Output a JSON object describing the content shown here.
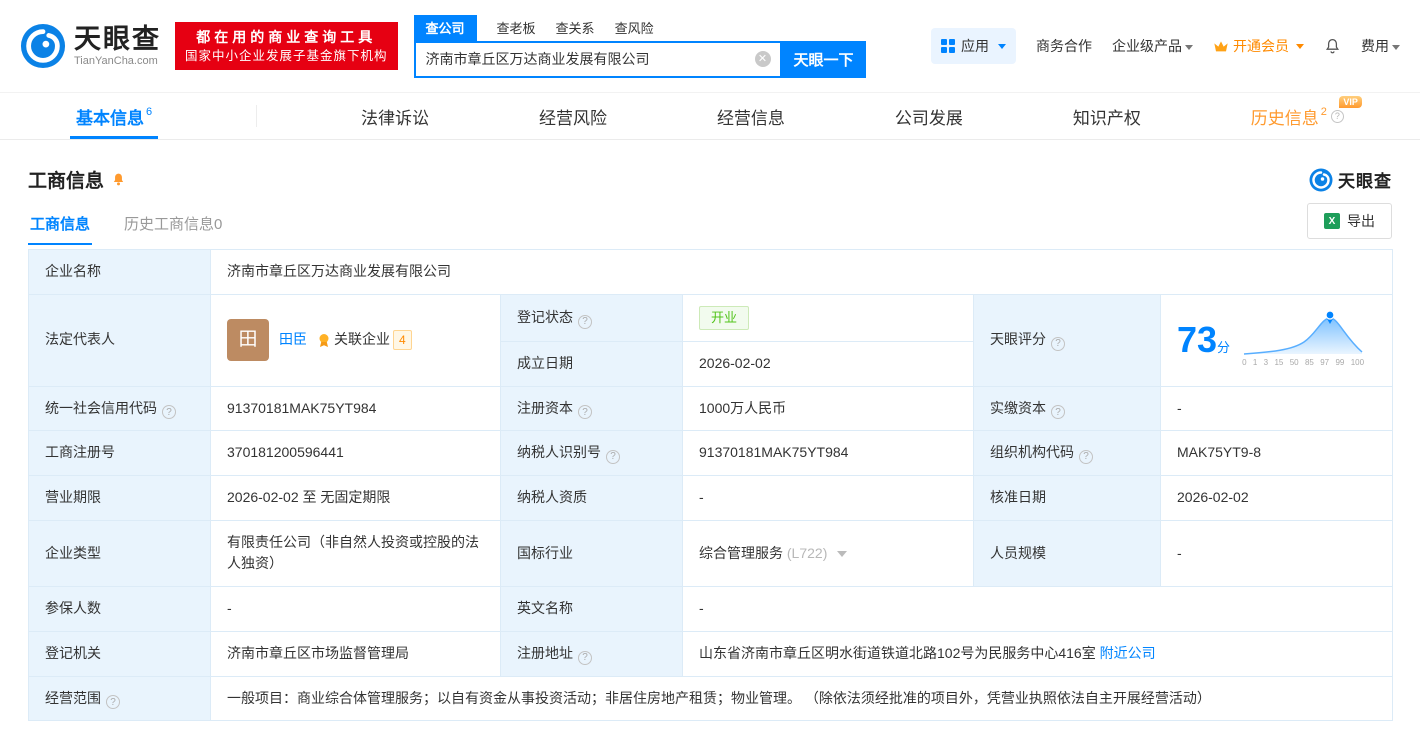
{
  "brand": {
    "name": "天眼查",
    "domain": "TianYanCha.com",
    "primary_color": "#0084ff",
    "red": "#e60012",
    "promo_line1": "都在用的商业查询工具",
    "promo_line2": "国家中小企业发展子基金旗下机构"
  },
  "header": {
    "search_tabs": [
      {
        "label": "查公司"
      },
      {
        "label": "查老板"
      },
      {
        "label": "查关系"
      },
      {
        "label": "查风险"
      }
    ],
    "search": {
      "value": "济南市章丘区万达商业发展有限公司",
      "button_label": "天眼一下"
    },
    "nav": {
      "apps": "应用",
      "cooperation": "商务合作",
      "enterprise": "企业级产品",
      "vip": "开通会员",
      "fee": "费用"
    }
  },
  "tabs": [
    {
      "label": "基本信息",
      "badge": "6"
    },
    {
      "label": "法律诉讼"
    },
    {
      "label": "经营风险"
    },
    {
      "label": "经营信息"
    },
    {
      "label": "公司发展"
    },
    {
      "label": "知识产权"
    },
    {
      "label": "历史信息",
      "badge": "2",
      "vip_tag": "VIP"
    }
  ],
  "section": {
    "title": "工商信息",
    "sub_tab_active": "工商信息",
    "sub_tab_history": "历史工商信息0",
    "export_label": "导出",
    "watermark_brand": "天眼查"
  },
  "info": {
    "company_name": {
      "label": "企业名称",
      "value": "济南市章丘区万达商业发展有限公司"
    },
    "legal_rep": {
      "label": "法定代表人",
      "avatar_char": "田",
      "name": "田臣",
      "related_label": "关联企业",
      "related_count": "4"
    },
    "reg_status": {
      "label": "登记状态",
      "value": "开业"
    },
    "establish_date": {
      "label": "成立日期",
      "value": "2026-02-02"
    },
    "score": {
      "label": "天眼评分",
      "value": "73",
      "unit": "分",
      "ticks": [
        "0",
        "1",
        "3",
        "15",
        "50",
        "85",
        "97",
        "99",
        "100"
      ]
    },
    "credit_code": {
      "label": "统一社会信用代码",
      "value": "91370181MAK75YT984"
    },
    "reg_capital": {
      "label": "注册资本",
      "value": "1000万人民币"
    },
    "paid_capital": {
      "label": "实缴资本",
      "value": "-"
    },
    "reg_number": {
      "label": "工商注册号",
      "value": "370181200596441"
    },
    "taxpayer_id": {
      "label": "纳税人识别号",
      "value": "91370181MAK75YT984"
    },
    "org_code": {
      "label": "组织机构代码",
      "value": "MAK75YT9-8"
    },
    "business_term": {
      "label": "营业期限",
      "value": "2026-02-02 至 无固定期限"
    },
    "taxpayer_quality": {
      "label": "纳税人资质",
      "value": "-"
    },
    "approved_date": {
      "label": "核准日期",
      "value": "2026-02-02"
    },
    "company_type": {
      "label": "企业类型",
      "value": "有限责任公司（非自然人投资或控股的法人独资）"
    },
    "industry": {
      "label": "国标行业",
      "value": "综合管理服务",
      "code": "(L722)"
    },
    "staff_size": {
      "label": "人员规模",
      "value": "-"
    },
    "insured_count": {
      "label": "参保人数",
      "value": "-"
    },
    "english_name": {
      "label": "英文名称",
      "value": "-"
    },
    "reg_authority": {
      "label": "登记机关",
      "value": "济南市章丘区市场监督管理局"
    },
    "reg_address": {
      "label": "注册地址",
      "value": "山东省济南市章丘区明水街道铁道北路102号为民服务中心416室",
      "nearby_link": "附近公司"
    },
    "business_scope": {
      "label": "经营范围",
      "value": "一般项目：商业综合体管理服务；以自有资金从事投资活动；非居住房地产租赁；物业管理。 （除依法须经批准的项目外，凭营业执照依法自主开展经营活动）"
    }
  }
}
